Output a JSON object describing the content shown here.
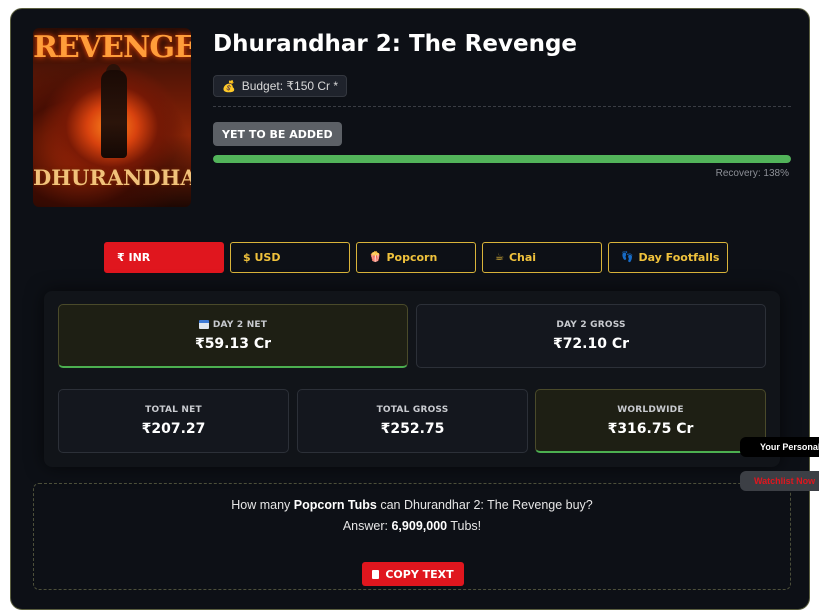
{
  "poster": {
    "top_title": "REVENGE",
    "main_title": "DHURANDHAR"
  },
  "movie": {
    "title": "Dhurandhar 2: The Revenge",
    "budget": "Budget: ₹150 Cr *",
    "status": "YET TO BE ADDED",
    "recovery_label": "Recovery: 138%",
    "recovery_bar_percent": 100
  },
  "tabs": [
    {
      "label": "₹ INR",
      "icon": "rupee-icon",
      "active": true
    },
    {
      "label": "$ USD",
      "icon": "dollar-icon",
      "active": false
    },
    {
      "label": "Popcorn",
      "icon": "popcorn-icon",
      "active": false
    },
    {
      "label": "Chai",
      "icon": "chai-icon",
      "active": false
    },
    {
      "label": "Day Footfalls",
      "icon": "footfalls-icon",
      "active": false
    }
  ],
  "stats": {
    "day2_net": {
      "label": "DAY 2 NET",
      "value": "₹59.13 Cr"
    },
    "day2_gross": {
      "label": "DAY 2 GROSS",
      "value": "₹72.10 Cr"
    },
    "total_net": {
      "label": "TOTAL NET",
      "value": "₹207.27"
    },
    "total_gross": {
      "label": "TOTAL GROSS",
      "value": "₹252.75"
    },
    "worldwide": {
      "label": "WORLDWIDE",
      "value": "₹316.75 Cr"
    }
  },
  "fun": {
    "q_prefix": "How many ",
    "q_item": "Popcorn Tubs",
    "q_suffix": " can Dhurandhar 2: The Revenge buy?",
    "a_prefix": "Answer: ",
    "a_value": "6,909,000",
    "a_suffix": " Tubs!",
    "copy_label": "COPY TEXT"
  },
  "floating": {
    "widget1": "Your Personal",
    "widget2": "Watchlist Now"
  },
  "colors": {
    "accent_red": "#e0161e",
    "accent_gold": "#f0c23c",
    "progress_green": "#52b45a",
    "background": "#0d1016"
  }
}
